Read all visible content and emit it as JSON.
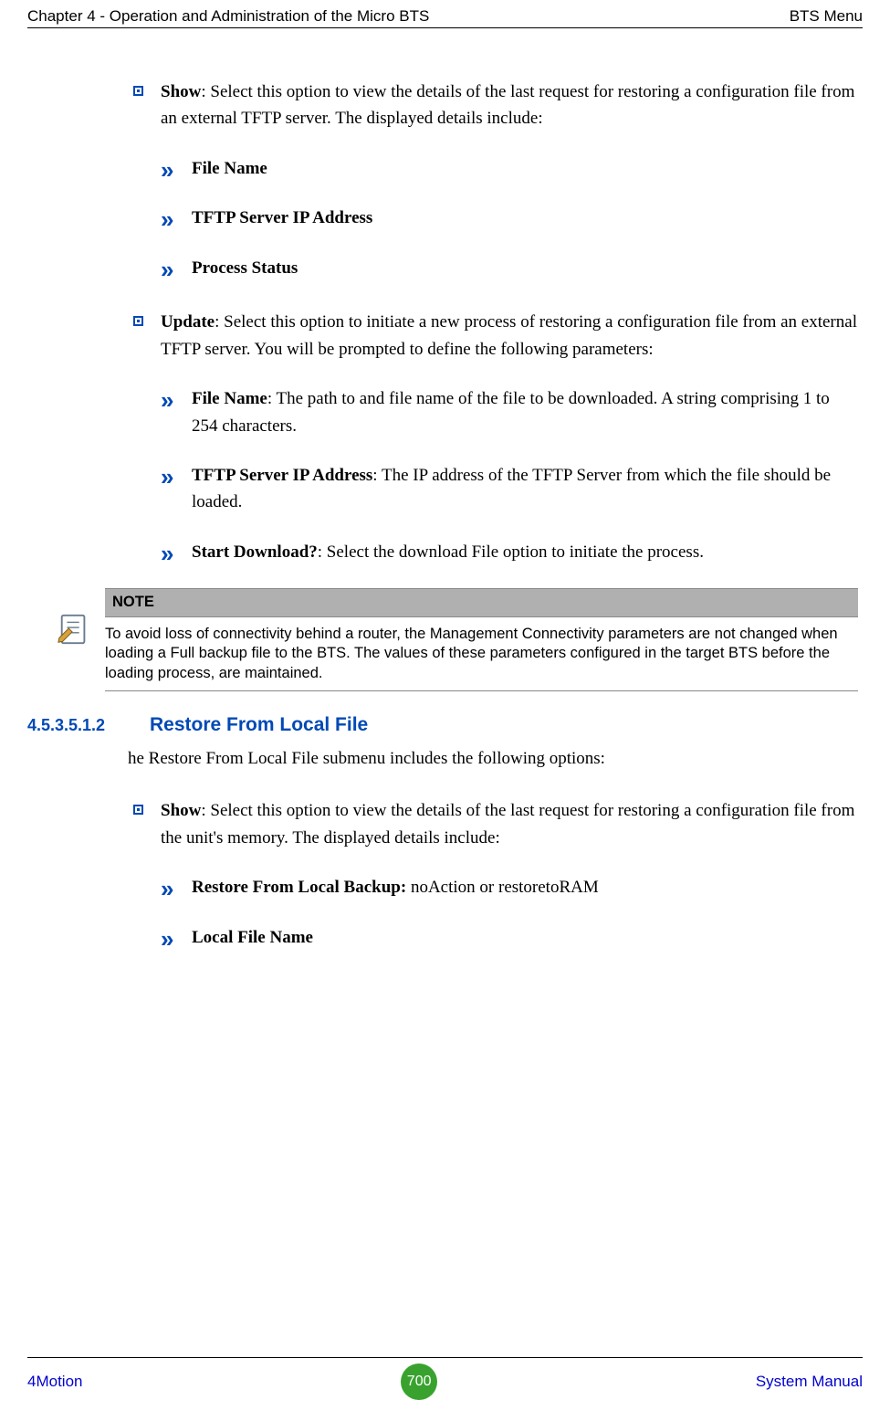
{
  "header": {
    "left": "Chapter 4 - Operation and Administration of the Micro BTS",
    "right": "BTS Menu"
  },
  "item_show": {
    "bold": "Show",
    "rest": ": Select this option to view the details of the last request for restoring a configuration file from an external TFTP server. The displayed details include:",
    "subs": {
      "a": "File Name",
      "b": "TFTP Server IP Address",
      "c": "Process Status"
    }
  },
  "item_update": {
    "bold": "Update",
    "rest": ": Select this option to initiate a new process of restoring a configuration file from an external TFTP server. You will be prompted to define the following parameters:",
    "subs": {
      "a_bold": "File Name",
      "a_rest": ": The path to and file name of the file to be downloaded. A string comprising 1 to 254 characters.",
      "b_bold": "TFTP Server IP Address",
      "b_rest": ": The IP address of the TFTP Server from which the file should be loaded.",
      "c_bold": "Start Download?",
      "c_rest": ": Select the download File option to initiate the process."
    }
  },
  "note": {
    "label": "NOTE",
    "body": "To avoid loss of connectivity behind a router, the Management Connectivity parameters are not changed when loading a Full backup file to the BTS. The values of these parameters configured in the target BTS before the loading process, are maintained."
  },
  "section2": {
    "num": "4.5.3.5.1.2",
    "title": "Restore From Local File",
    "intro": "he Restore From Local File submenu includes the following options:",
    "show_bold": "Show",
    "show_rest": ": Select this option to view the details of the last request for restoring a configuration file from the unit's memory. The displayed details include:",
    "sub_a_bold": "Restore From Local Backup: ",
    "sub_a_rest": "noAction or restoretoRAM",
    "sub_b": "Local File Name"
  },
  "footer": {
    "left": "4Motion",
    "page": "700",
    "right": "System Manual"
  }
}
